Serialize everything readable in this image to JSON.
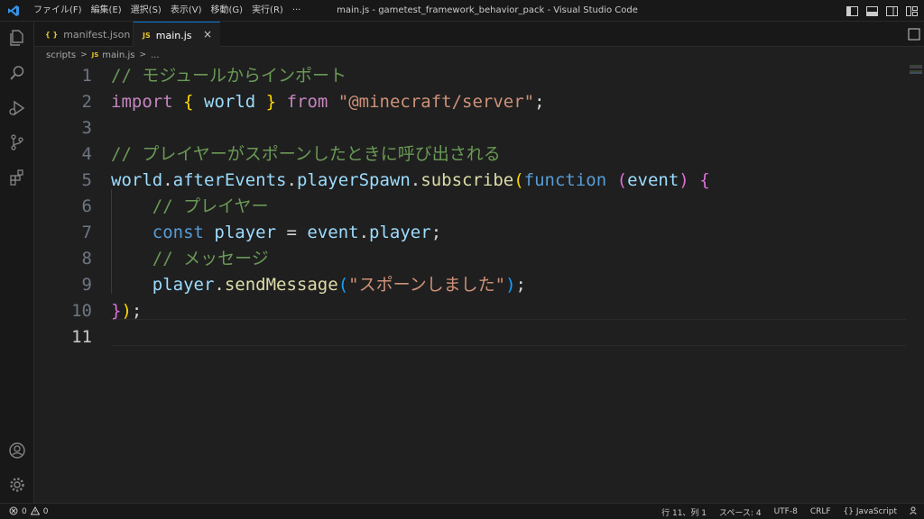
{
  "titlebar": {
    "menu": [
      "ファイル(F)",
      "編集(E)",
      "選択(S)",
      "表示(V)",
      "移動(G)",
      "実行(R)",
      "···"
    ],
    "title": "main.js - gametest_framework_behavior_pack - Visual Studio Code"
  },
  "tabs": [
    {
      "icon": "{ }",
      "label": "manifest.json"
    },
    {
      "icon": "JS",
      "label": "main.js",
      "close": "×"
    }
  ],
  "breadcrumb": {
    "folder": "scripts",
    "sep": ">",
    "js_icon": "JS",
    "file": "main.js",
    "more": "..."
  },
  "editor": {
    "line_numbers": [
      "1",
      "2",
      "3",
      "4",
      "5",
      "6",
      "7",
      "8",
      "9",
      "10",
      "11"
    ],
    "lines": [
      [
        {
          "c": "c-comment",
          "t": "// モジュールからインポート"
        }
      ],
      [
        {
          "c": "c-kw",
          "t": "import"
        },
        {
          "c": "c-plain",
          "t": " "
        },
        {
          "c": "c-p1",
          "t": "{"
        },
        {
          "c": "c-plain",
          "t": " "
        },
        {
          "c": "c-var",
          "t": "world"
        },
        {
          "c": "c-plain",
          "t": " "
        },
        {
          "c": "c-p1",
          "t": "}"
        },
        {
          "c": "c-plain",
          "t": " "
        },
        {
          "c": "c-kw",
          "t": "from"
        },
        {
          "c": "c-plain",
          "t": " "
        },
        {
          "c": "c-str",
          "t": "\"@minecraft/server\""
        },
        {
          "c": "c-plain",
          "t": ";"
        }
      ],
      [],
      [
        {
          "c": "c-comment",
          "t": "// プレイヤーがスポーンしたときに呼び出される"
        }
      ],
      [
        {
          "c": "c-var",
          "t": "world"
        },
        {
          "c": "c-plain",
          "t": "."
        },
        {
          "c": "c-var",
          "t": "afterEvents"
        },
        {
          "c": "c-plain",
          "t": "."
        },
        {
          "c": "c-var",
          "t": "playerSpawn"
        },
        {
          "c": "c-plain",
          "t": "."
        },
        {
          "c": "c-fn",
          "t": "subscribe"
        },
        {
          "c": "c-p1",
          "t": "("
        },
        {
          "c": "c-decl",
          "t": "function"
        },
        {
          "c": "c-plain",
          "t": " "
        },
        {
          "c": "c-p2",
          "t": "("
        },
        {
          "c": "c-var",
          "t": "event"
        },
        {
          "c": "c-p2",
          "t": ")"
        },
        {
          "c": "c-plain",
          "t": " "
        },
        {
          "c": "c-p2",
          "t": "{"
        }
      ],
      [
        {
          "c": "c-plain",
          "t": "    "
        },
        {
          "c": "c-comment",
          "t": "// プレイヤー"
        }
      ],
      [
        {
          "c": "c-plain",
          "t": "    "
        },
        {
          "c": "c-decl",
          "t": "const"
        },
        {
          "c": "c-plain",
          "t": " "
        },
        {
          "c": "c-var",
          "t": "player"
        },
        {
          "c": "c-plain",
          "t": " = "
        },
        {
          "c": "c-var",
          "t": "event"
        },
        {
          "c": "c-plain",
          "t": "."
        },
        {
          "c": "c-var",
          "t": "player"
        },
        {
          "c": "c-plain",
          "t": ";"
        }
      ],
      [
        {
          "c": "c-plain",
          "t": "    "
        },
        {
          "c": "c-comment",
          "t": "// メッセージ"
        }
      ],
      [
        {
          "c": "c-plain",
          "t": "    "
        },
        {
          "c": "c-var",
          "t": "player"
        },
        {
          "c": "c-plain",
          "t": "."
        },
        {
          "c": "c-fn",
          "t": "sendMessage"
        },
        {
          "c": "c-p3",
          "t": "("
        },
        {
          "c": "c-str",
          "t": "\"スポーンしました\""
        },
        {
          "c": "c-p3",
          "t": ")"
        },
        {
          "c": "c-plain",
          "t": ";"
        }
      ],
      [
        {
          "c": "c-p2",
          "t": "}"
        },
        {
          "c": "c-p1",
          "t": ")"
        },
        {
          "c": "c-plain",
          "t": ";"
        }
      ],
      []
    ]
  },
  "statusbar": {
    "errors": "0",
    "warnings": "0",
    "position": "行 11、列 1",
    "spaces": "スペース: 4",
    "encoding": "UTF-8",
    "eol": "CRLF",
    "language_icon": "{}",
    "language": "JavaScript"
  }
}
